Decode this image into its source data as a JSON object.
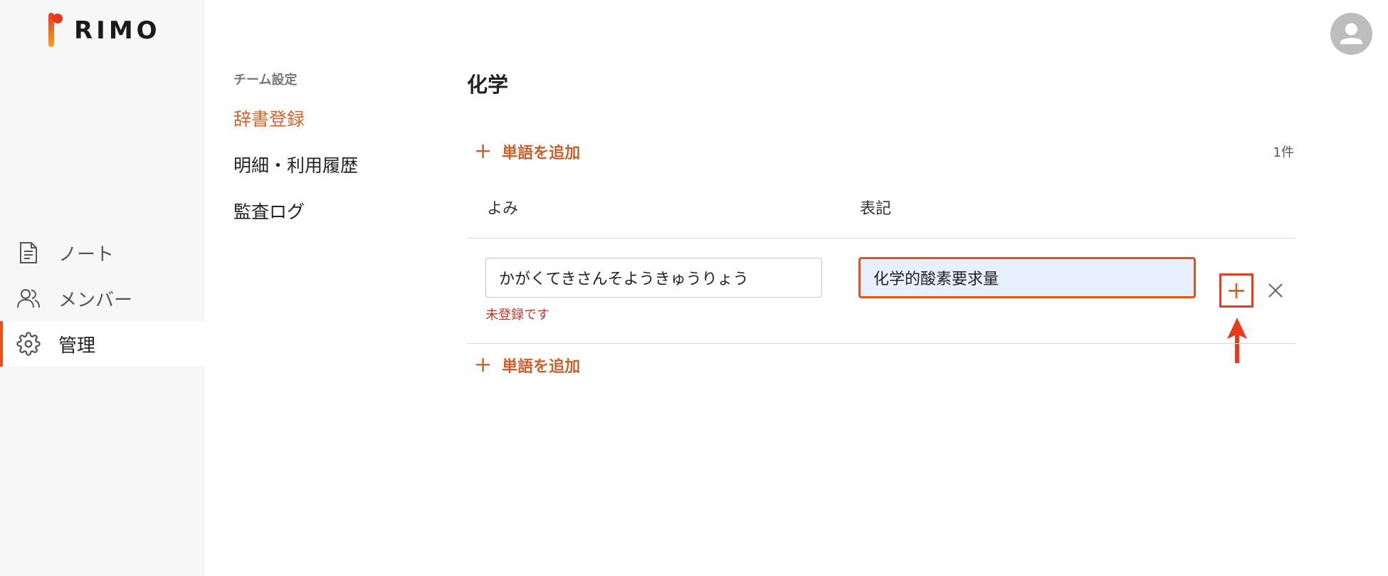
{
  "brand": {
    "name": "RIMO",
    "accent": "#e8501c"
  },
  "sidebar": {
    "items": [
      {
        "label": "ノート",
        "icon": "document-icon",
        "active": false
      },
      {
        "label": "メンバー",
        "icon": "users-icon",
        "active": false
      },
      {
        "label": "管理",
        "icon": "gear-icon",
        "active": true
      }
    ]
  },
  "settings_nav": {
    "section": "チーム設定",
    "links": [
      {
        "label": "辞書登録",
        "active": true
      },
      {
        "label": "明細・利用履歴",
        "active": false
      },
      {
        "label": "監査ログ",
        "active": false
      }
    ]
  },
  "main": {
    "title": "化学",
    "add_word_label": "単語を追加",
    "count": "1件",
    "columns": {
      "reading": "よみ",
      "notation": "表記"
    },
    "row": {
      "reading_value": "かがくてきさんそようきゅうりょう",
      "notation_value": "化学的酸素要求量",
      "error": "未登録です"
    },
    "confirm_icon": "plus-icon",
    "delete_icon": "close-icon"
  },
  "header": {
    "avatar_icon": "user-icon"
  }
}
